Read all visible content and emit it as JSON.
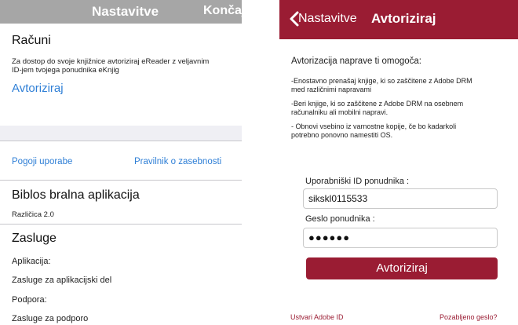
{
  "left": {
    "header": {
      "title": "Nastavitve",
      "done": "Končaj"
    },
    "accounts": {
      "title": "Računi",
      "description_line1": "Za dostop do svoje knjižnice avtoriziraj eReader z veljavnim",
      "description_line2": "ID-jem tvojega ponudnika eKnjig",
      "authorize_link": "Avtoriziraj"
    },
    "links": {
      "terms": "Pogoji uporabe",
      "privacy": "Pravilnik o zasebnosti"
    },
    "app": {
      "title": "Biblos bralna aplikacija",
      "version": "Različica 2.0"
    },
    "credits": {
      "title": "Zasluge",
      "items": [
        "Aplikacija:",
        "Zasluge za aplikacijski del",
        "Podpora:",
        "Zasluge za podporo"
      ]
    }
  },
  "right": {
    "header": {
      "back": "Nastavitve",
      "title": "Avtoriziraj"
    },
    "intro": "Avtorizacija naprave ti omogoča:",
    "bullets": [
      {
        "line1": "-Enostavno prenašaj knjige, ki so zaščitene z Adobe DRM",
        "line2": "med različnimi napravami"
      },
      {
        "line1": "-Beri knjige, ki so zaščitene z Adobe DRM na osebnem",
        "line2": "računalniku ali mobilni napravi."
      },
      {
        "line1": "- Obnovi vsebino iz varnostne kopije, če bo kadarkoli",
        "line2": "potrebno ponovno namestiti OS."
      }
    ],
    "form": {
      "user_label": "Uporabniški ID ponudnika :",
      "user_value": "sikskl0115533",
      "pass_label": "Geslo ponudnika :",
      "pass_value": "●●●●●●",
      "submit": "Avtoriziraj"
    },
    "footer": {
      "create_id": "Ustvari Adobe ID",
      "forgot": "Pozabljeno geslo?"
    },
    "colors": {
      "accent": "#9a1c33"
    }
  }
}
